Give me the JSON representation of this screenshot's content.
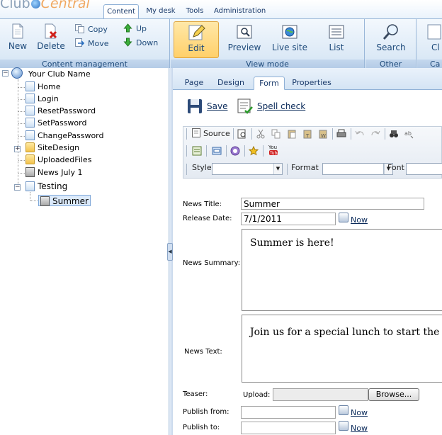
{
  "app": {
    "logo_part1": "Club",
    "logo_part2": "Central",
    "tabs": [
      {
        "label": "Content"
      },
      {
        "label": "My desk"
      },
      {
        "label": "Tools"
      },
      {
        "label": "Administration"
      }
    ]
  },
  "ribbon": {
    "content_management": {
      "label": "Content management",
      "new": "New",
      "delete": "Delete",
      "copy": "Copy",
      "move": "Move",
      "up": "Up",
      "down": "Down"
    },
    "view_mode": {
      "label": "View mode",
      "edit": "Edit",
      "preview": "Preview",
      "live_site": "Live site",
      "list": "List"
    },
    "other": {
      "label": "Other",
      "search": "Search"
    },
    "cut_label": "Ca",
    "cut_button": "Cl"
  },
  "tree": {
    "root": "Your Club Name",
    "items": [
      {
        "label": "Home"
      },
      {
        "label": "Login"
      },
      {
        "label": "ResetPassword"
      },
      {
        "label": "SetPassword"
      },
      {
        "label": "ChangePassword"
      },
      {
        "label": "SiteDesign"
      },
      {
        "label": "UploadedFiles"
      },
      {
        "label": "News July 1"
      },
      {
        "label": "Testing"
      },
      {
        "label": "Summer"
      }
    ]
  },
  "subtabs": [
    {
      "label": "Page"
    },
    {
      "label": "Design"
    },
    {
      "label": "Form"
    },
    {
      "label": "Properties"
    }
  ],
  "actions": {
    "save": "Save",
    "spell_check": "Spell check"
  },
  "editor": {
    "source": "Source",
    "style_label": "Style",
    "format_label": "Format",
    "font_label": "Font"
  },
  "form": {
    "news_title": {
      "label": "News Title:",
      "value": "Summer"
    },
    "release_date": {
      "label": "Release Date:",
      "value": "7/1/2011",
      "now": "Now"
    },
    "news_summary": {
      "label": "News Summary:",
      "value": "Summer is here!"
    },
    "news_text": {
      "label": "News Text:",
      "value": "Join us for a special lunch to start the season"
    },
    "teaser": {
      "label": "Teaser:",
      "upload": "Upload:",
      "browse": "Browse..."
    },
    "publish_from": {
      "label": "Publish from:",
      "now": "Now"
    },
    "publish_to": {
      "label": "Publish to:",
      "now": "Now"
    }
  }
}
